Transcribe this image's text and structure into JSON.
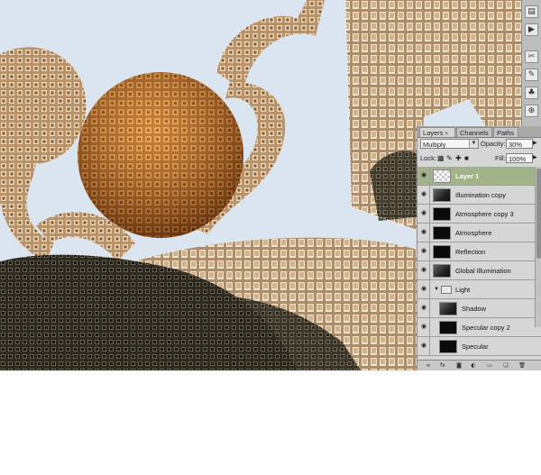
{
  "layers_panel": {
    "tabs": [
      {
        "label": "Layers",
        "active": true,
        "close": "×"
      },
      {
        "label": "Channels",
        "active": false
      },
      {
        "label": "Paths",
        "active": false
      }
    ],
    "blend_mode": "Multiply",
    "opacity_label": "Opacity:",
    "opacity_value": "30%",
    "lock_label": "Lock:",
    "fill_label": "Fill:",
    "fill_value": "100%",
    "layers": [
      {
        "name": "Layer 1",
        "selected": true,
        "thumb": "white",
        "visible": true
      },
      {
        "name": "Illumination copy",
        "selected": false,
        "thumb": "grey",
        "visible": true
      },
      {
        "name": "Atmosphere copy 3",
        "selected": false,
        "thumb": "black",
        "visible": true
      },
      {
        "name": "Atmosphere",
        "selected": false,
        "thumb": "black",
        "visible": true
      },
      {
        "name": "Reflection",
        "selected": false,
        "thumb": "black",
        "visible": true
      },
      {
        "name": "Global Illumination",
        "selected": false,
        "thumb": "grey",
        "visible": true
      },
      {
        "name": "Light",
        "group": true,
        "visible": true
      },
      {
        "name": "Shadow",
        "selected": false,
        "thumb": "grey",
        "visible": true
      },
      {
        "name": "Specular copy 2",
        "selected": false,
        "thumb": "black",
        "visible": true
      },
      {
        "name": "Specular",
        "selected": false,
        "thumb": "black",
        "visible": true
      }
    ],
    "bottom_icons": [
      "link-icon",
      "fx-icon",
      "mask-icon",
      "adjustment-icon",
      "group-icon",
      "new-layer-icon",
      "trash-icon"
    ]
  },
  "toolstrip": {
    "icons": [
      "history-icon",
      "actions-icon",
      "tools-icon",
      "brush-icon",
      "clone-icon",
      "stamp-icon",
      "character-icon",
      "paragraph-icon"
    ]
  },
  "colors": {
    "sky": "#dbe5ef",
    "sphere": "#c8772a",
    "tube": "#c7a67c",
    "selected_layer": "#a2b38a",
    "panel": "#d6d6d6"
  }
}
